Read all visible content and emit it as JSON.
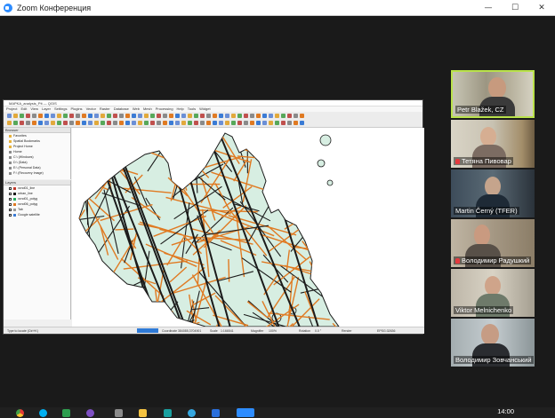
{
  "window": {
    "title": "Zoom Конференция",
    "minimize_label": "—",
    "maximize_label": "☐",
    "close_label": "✕"
  },
  "shared_screen": {
    "qgis_title": "MAPKA_analysis_Pit — QGIS",
    "menu": [
      "Project",
      "Edit",
      "View",
      "Layer",
      "Settings",
      "Plugins",
      "Vector",
      "Raster",
      "Database",
      "Web",
      "Mesh",
      "Processing",
      "Help",
      "Tools",
      "Widget"
    ],
    "browser_header": "Browser",
    "browser_items": [
      "Favorites",
      "Spatial Bookmarks",
      "Project Home",
      "Home",
      "C:\\ (Windows)",
      "D:\\ (Data)",
      "E:\\ (Personal Data)",
      "F:\\ (Recovery Image)"
    ],
    "layers_header": "Layers",
    "layers": [
      "vznd01_line",
      "urban_line",
      "vznd01_polyg",
      "vznd06_polyg",
      "Tab",
      "Google satellite"
    ],
    "locator_placeholder": "Type to locate (Ctrl+K)",
    "status": {
      "coordinate_label": "Coordinate",
      "coordinate_value": "384085,3704901",
      "scale_label": "Scale",
      "scale_value": "1:166541",
      "magnifier_label": "Magnifier",
      "magnifier_value": "100%",
      "rotation_label": "Rotation",
      "rotation_value": "0.0 °",
      "render_label": "Render",
      "crs_label": "EPSG:32636"
    },
    "colors": {
      "land": "#d7eee2",
      "lines": "#e07a22",
      "dark": "#1b1b1b"
    }
  },
  "participants": [
    {
      "name": "Petr Blažek, CZ",
      "muted": false,
      "active": true
    },
    {
      "name": "Тетяна Пивовар",
      "muted": true,
      "active": false
    },
    {
      "name": "Martin Černý (TFER)",
      "muted": false,
      "active": false
    },
    {
      "name": "Володимир Радушкий",
      "muted": true,
      "active": false
    },
    {
      "name": "Viktor Melnichenko",
      "muted": false,
      "active": false
    },
    {
      "name": "Володимир Зовчанський",
      "muted": false,
      "active": false
    }
  ],
  "taskbar": {
    "time": "14:00"
  }
}
